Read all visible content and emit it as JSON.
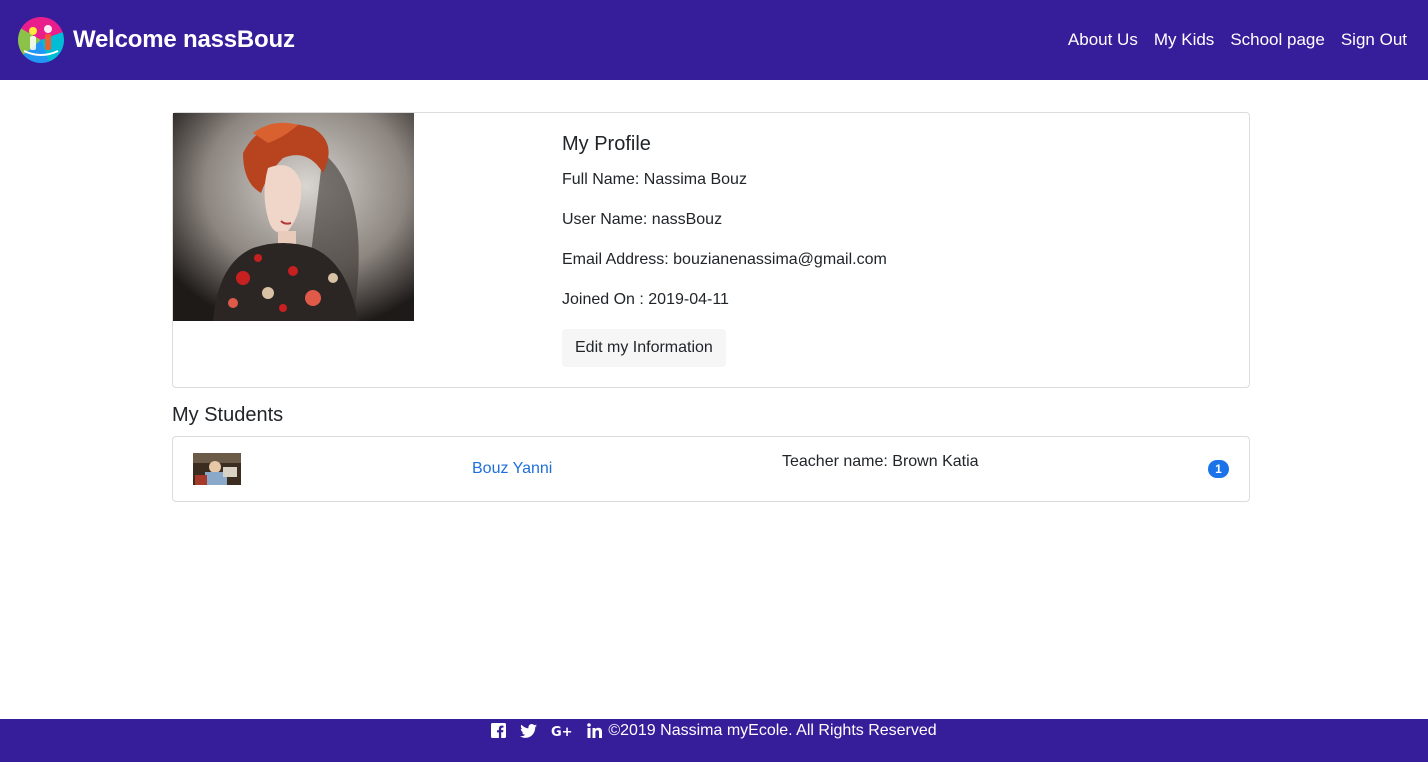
{
  "navbar": {
    "brand": "Welcome nassBouz",
    "links": [
      "About Us",
      "My Kids",
      "School page",
      "Sign Out"
    ],
    "background": "#361d9a"
  },
  "profile": {
    "title": "My Profile",
    "full_name": "Full Name: Nassima Bouz",
    "user_name": "User Name: nassBouz",
    "email": "Email Address: bouzianenassima@gmail.com",
    "joined": "Joined On : 2019-04-11",
    "edit_button": "Edit my Information"
  },
  "students": {
    "title": "My Students",
    "items": [
      {
        "name": "Bouz Yanni",
        "teacher": "Teacher name: Brown Katia",
        "count": "1"
      }
    ]
  },
  "footer": {
    "social_icons": [
      "facebook-icon",
      "twitter-icon",
      "google-plus-icon",
      "linkedin-icon"
    ],
    "copyright": "©2019 Nassima myEcole. All Rights Reserved",
    "background": "#361d9a"
  },
  "colors": {
    "link": "#1e6fdc",
    "badge": "#1a73e8"
  }
}
